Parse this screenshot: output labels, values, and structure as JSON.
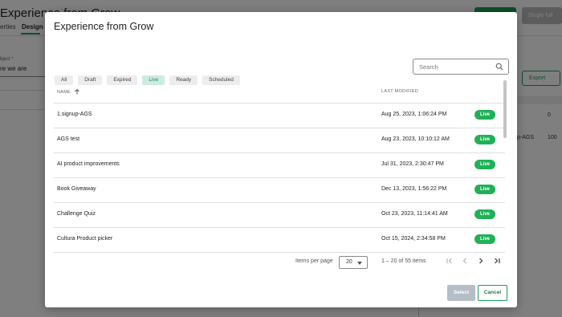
{
  "background": {
    "title": "Experience from Grow",
    "tabs": [
      {
        "label": "erties"
      },
      {
        "label": "Design"
      }
    ],
    "top_right_button": "Single full",
    "field": {
      "label": "bject *",
      "value": "re we are"
    },
    "export_label": "Export",
    "table": [
      {
        "name": "",
        "value": "0"
      },
      {
        "name": "p-AGS",
        "value": "100"
      }
    ]
  },
  "modal": {
    "title": "Experience from Grow",
    "filters": [
      {
        "label": "All",
        "active": false
      },
      {
        "label": "Draft",
        "active": false
      },
      {
        "label": "Expired",
        "active": false
      },
      {
        "label": "Live",
        "active": true
      },
      {
        "label": "Ready",
        "active": false
      },
      {
        "label": "Scheduled",
        "active": false
      }
    ],
    "search": {
      "placeholder": "Search",
      "value": ""
    },
    "columns": {
      "name": "NAME",
      "last_modified": "LAST MODIFIED"
    },
    "rows": [
      {
        "name": "1.signup-AGS",
        "modified": "Aug 25, 2023, 1:06:24 PM",
        "status": "Live"
      },
      {
        "name": "AGS test",
        "modified": "Aug 23, 2023, 10:10:12 AM",
        "status": "Live"
      },
      {
        "name": "AI product improvements",
        "modified": "Jul 31, 2023, 2:30:47 PM",
        "status": "Live"
      },
      {
        "name": "Book Giveaway",
        "modified": "Dec 13, 2023, 1:56:22 PM",
        "status": "Live"
      },
      {
        "name": "Challenge Quiz",
        "modified": "Oct 23, 2023, 11:14:41 AM",
        "status": "Live"
      },
      {
        "name": "Cultura Product picker",
        "modified": "Oct 15, 2024, 2:34:58 PM",
        "status": "Live"
      }
    ],
    "pagination": {
      "items_per_page_label": "Items per page",
      "items_per_page": "20",
      "range": "1 – 20 of 55 items"
    },
    "buttons": {
      "select": "Select",
      "cancel": "Cancel"
    }
  },
  "colors": {
    "accent": "#1b9e5a",
    "live_badge": "#1fb157",
    "active_chip_bg": "#cdebe3"
  }
}
